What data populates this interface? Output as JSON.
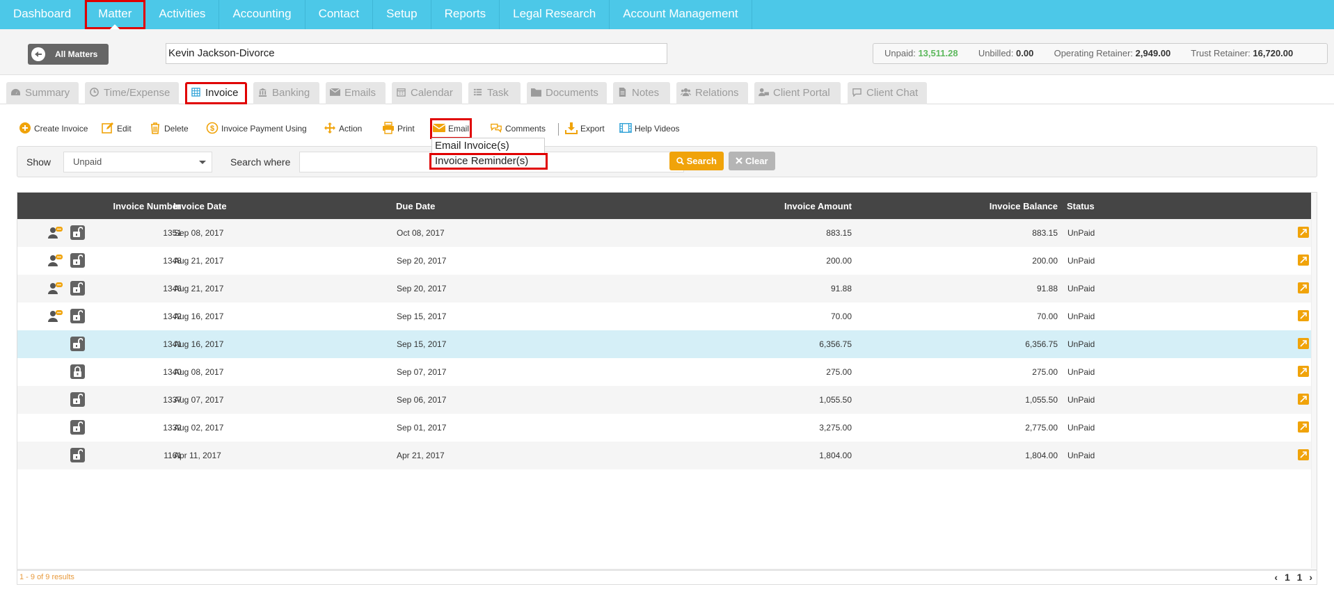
{
  "nav": {
    "items": [
      "Dashboard",
      "Matter",
      "Activities",
      "Accounting",
      "Contact",
      "Setup",
      "Reports",
      "Legal Research",
      "Account Management"
    ],
    "active": "Matter"
  },
  "matter": {
    "all_matters_label": "All Matters",
    "name": "Kevin Jackson-Divorce",
    "unpaid_label": "Unpaid:",
    "unpaid_value": "13,511.28",
    "unbilled_label": "Unbilled:",
    "unbilled_value": "0.00",
    "operating_label": "Operating Retainer:",
    "operating_value": "2,949.00",
    "trust_label": "Trust Retainer:",
    "trust_value": "16,720.00"
  },
  "tabs": [
    {
      "label": "Summary",
      "icon": "dashboard-icon"
    },
    {
      "label": "Time/Expense",
      "icon": "clock-icon"
    },
    {
      "label": "Invoice",
      "icon": "calendar-grid-icon"
    },
    {
      "label": "Banking",
      "icon": "bank-icon"
    },
    {
      "label": "Emails",
      "icon": "envelope-icon"
    },
    {
      "label": "Calendar",
      "icon": "calendar-icon"
    },
    {
      "label": "Task",
      "icon": "task-list-icon"
    },
    {
      "label": "Documents",
      "icon": "folder-icon"
    },
    {
      "label": "Notes",
      "icon": "note-icon"
    },
    {
      "label": "Relations",
      "icon": "users-icon"
    },
    {
      "label": "Client Portal",
      "icon": "portal-icon"
    },
    {
      "label": "Client Chat",
      "icon": "chat-icon"
    }
  ],
  "toolbar": {
    "create_invoice": "Create Invoice",
    "edit": "Edit",
    "delete": "Delete",
    "invoice_payment": "Invoice Payment Using",
    "action": "Action",
    "print": "Print",
    "email": "Email",
    "comments": "Comments",
    "export": "Export",
    "help_videos": "Help Videos"
  },
  "email_menu": {
    "items": [
      "Email Invoice(s)",
      "Invoice Reminder(s)"
    ]
  },
  "filter": {
    "show_label": "Show",
    "show_value": "Unpaid",
    "search_where_label": "Search where",
    "search_value": "",
    "search_button": "Search",
    "clear_button": "Clear"
  },
  "table": {
    "columns": [
      "Invoice Number",
      "Invoice Date",
      "Due Date",
      "Invoice Amount",
      "Invoice Balance",
      "Status"
    ],
    "rows": [
      {
        "number": "1351",
        "date": "Sep 08, 2017",
        "due": "Oct 08, 2017",
        "amount": "883.15",
        "balance": "883.15",
        "status": "UnPaid",
        "person": true,
        "lock": "open"
      },
      {
        "number": "1348",
        "date": "Aug 21, 2017",
        "due": "Sep 20, 2017",
        "amount": "200.00",
        "balance": "200.00",
        "status": "UnPaid",
        "person": true,
        "lock": "open"
      },
      {
        "number": "1346",
        "date": "Aug 21, 2017",
        "due": "Sep 20, 2017",
        "amount": "91.88",
        "balance": "91.88",
        "status": "UnPaid",
        "person": true,
        "lock": "open"
      },
      {
        "number": "1342",
        "date": "Aug 16, 2017",
        "due": "Sep 15, 2017",
        "amount": "70.00",
        "balance": "70.00",
        "status": "UnPaid",
        "person": true,
        "lock": "open"
      },
      {
        "number": "1341",
        "date": "Aug 16, 2017",
        "due": "Sep 15, 2017",
        "amount": "6,356.75",
        "balance": "6,356.75",
        "status": "UnPaid",
        "person": false,
        "lock": "open",
        "selected": true
      },
      {
        "number": "1340",
        "date": "Aug 08, 2017",
        "due": "Sep 07, 2017",
        "amount": "275.00",
        "balance": "275.00",
        "status": "UnPaid",
        "person": false,
        "lock": "closed"
      },
      {
        "number": "1337",
        "date": "Aug 07, 2017",
        "due": "Sep 06, 2017",
        "amount": "1,055.50",
        "balance": "1,055.50",
        "status": "UnPaid",
        "person": false,
        "lock": "open"
      },
      {
        "number": "1332",
        "date": "Aug 02, 2017",
        "due": "Sep 01, 2017",
        "amount": "3,275.00",
        "balance": "2,775.00",
        "status": "UnPaid",
        "person": false,
        "lock": "open"
      },
      {
        "number": "1161",
        "date": "Apr 11, 2017",
        "due": "Apr 21, 2017",
        "amount": "1,804.00",
        "balance": "1,804.00",
        "status": "UnPaid",
        "person": false,
        "lock": "open"
      }
    ]
  },
  "footer": {
    "results": "1 - 9 of 9 results",
    "prev": "‹",
    "page_first": "1",
    "page_last": "1",
    "next": "›"
  },
  "colors": {
    "nav_bg": "#4cc8e8",
    "accent_orange": "#f0a30a",
    "highlight_red": "#e00000",
    "selected_row": "#d5eff7",
    "unpaid_green": "#5cb85c"
  }
}
